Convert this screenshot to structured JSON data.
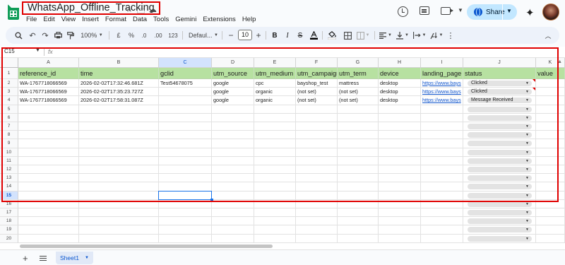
{
  "doc": {
    "title": "WhatsApp_Offline_Tracking",
    "menu": [
      "File",
      "Edit",
      "View",
      "Insert",
      "Format",
      "Data",
      "Tools",
      "Gemini",
      "Extensions",
      "Help"
    ],
    "share_label": "Share"
  },
  "toolbar": {
    "zoom": "100%",
    "currency": "£",
    "percent": "%",
    "dec_decrease": ".0",
    "dec_increase": ".00",
    "number_format": "123",
    "font": "Defaul...",
    "font_size": "10",
    "bold": "B",
    "italic": "I"
  },
  "formula_bar": {
    "cell_ref": "C15",
    "fx": "fx"
  },
  "columns": [
    "A",
    "B",
    "C",
    "D",
    "E",
    "F",
    "G",
    "H",
    "I",
    "J",
    "K"
  ],
  "selected_column": "C",
  "selected_row": 15,
  "row_numbers": [
    1,
    2,
    3,
    4,
    5,
    6,
    7,
    8,
    9,
    10,
    11,
    12,
    13,
    14,
    15,
    16,
    17,
    18,
    19,
    20
  ],
  "headers": [
    "reference_id",
    "time",
    "gclid",
    "utm_source",
    "utm_medium",
    "utm_campaign",
    "utm_term",
    "device",
    "landing_page",
    "status",
    "value"
  ],
  "rows": [
    {
      "reference_id": "WA-1767718066569",
      "time": "2026-02-02T17:32:46.681Z",
      "gclid": "Test54678075",
      "utm_source": "google",
      "utm_medium": "cpc",
      "utm_campaign": "bayshop_test",
      "utm_term": "mattress",
      "device": "desktop",
      "landing_page": "https://www.bays",
      "status": "Clicked"
    },
    {
      "reference_id": "WA-1767718066569",
      "time": "2026-02-02T17:35:23.727Z",
      "gclid": "",
      "utm_source": "google",
      "utm_medium": "organic",
      "utm_campaign": "(not set)",
      "utm_term": "(not set)",
      "device": "desktop",
      "landing_page": "https://www.bays",
      "status": "Clicked"
    },
    {
      "reference_id": "WA-1767718066569",
      "time": "2026-02-02T17:58:31.087Z",
      "gclid": "",
      "utm_source": "google",
      "utm_medium": "organic",
      "utm_campaign": "(not set)",
      "utm_term": "(not set)",
      "device": "desktop",
      "landing_page": "https://www.bays",
      "status": "Message Received"
    }
  ],
  "sheets": [
    {
      "name": "Sheet1",
      "active": true
    }
  ]
}
